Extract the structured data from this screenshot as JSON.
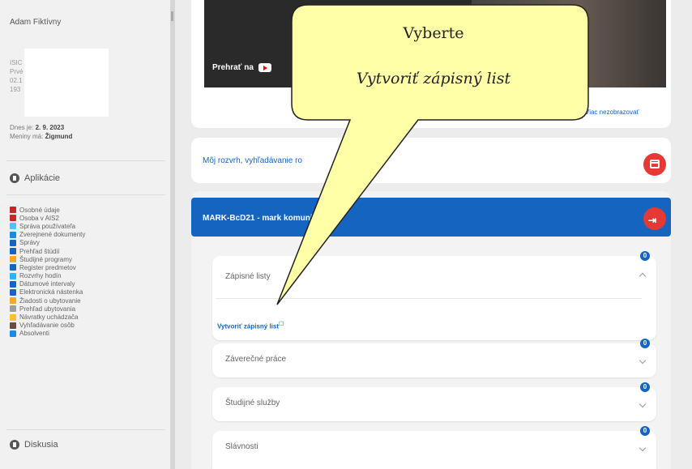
{
  "sidebar": {
    "user_name": "Adam Fiktívny",
    "id_labels": [
      "ISIC",
      "",
      "Prvé",
      "02.1",
      "193"
    ],
    "today_label": "Dnes je:",
    "today_date": "2. 9. 2023",
    "nameday_label": "Meniny má:",
    "nameday_name": "Žigmund",
    "apps_heading": "Aplikácie",
    "apps": [
      {
        "label": "Osobné údaje",
        "icon": "person-icon",
        "color": "#c62828"
      },
      {
        "label": "Osoba v AIS2",
        "icon": "person-icon",
        "color": "#c62828"
      },
      {
        "label": "Správa používateľa",
        "icon": "users-icon",
        "color": "#4fc3f7"
      },
      {
        "label": "Zverejnené dokumenty",
        "icon": "document-icon",
        "color": "#1e88e5"
      },
      {
        "label": "Správy",
        "icon": "mail-icon",
        "color": "#1565c0"
      },
      {
        "label": "Prehľad štúdií",
        "icon": "study-icon",
        "color": "#1565c0"
      },
      {
        "label": "Študijné programy",
        "icon": "program-icon",
        "color": "#f9a825"
      },
      {
        "label": "Register predmetov",
        "icon": "register-icon",
        "color": "#1565c0"
      },
      {
        "label": "Rozvrhy hodín",
        "icon": "timetable-icon",
        "color": "#29b6f6"
      },
      {
        "label": "Dátumové intervaly",
        "icon": "calendar-icon",
        "color": "#1565c0"
      },
      {
        "label": "Elektronická nástenka",
        "icon": "board-icon",
        "color": "#1565c0"
      },
      {
        "label": "Žiadosti o ubytovanie",
        "icon": "accommodation-icon",
        "color": "#f9a825"
      },
      {
        "label": "Prehľad ubytovania",
        "icon": "list-icon",
        "color": "#9e9e9e"
      },
      {
        "label": "Návratky uchádzača",
        "icon": "return-icon",
        "color": "#fbc02d"
      },
      {
        "label": "Vyhľadávanie osôb",
        "icon": "person-search-icon",
        "color": "#6d4c41"
      },
      {
        "label": "Absolventi",
        "icon": "graduate-icon",
        "color": "#1e88e5"
      }
    ],
    "discussion_heading": "Diskusia"
  },
  "video": {
    "watch_label": "Prehrať na",
    "more_link": "Viac nezobrazovať"
  },
  "schedule": {
    "text": "Môj rozvrh, vyhľadávanie ro"
  },
  "course": {
    "title": "MARK-BcD21 - mark                komunikácia"
  },
  "sections": [
    {
      "title": "Zápisné listy",
      "badge": "0",
      "link": "Vytvoriť zápisný list",
      "link_ext": "☐"
    },
    {
      "title": "Záverečné práce",
      "badge": "0"
    },
    {
      "title": "Študijné služby",
      "badge": "0"
    },
    {
      "title": "Slávnosti",
      "badge": "0"
    }
  ],
  "callout": {
    "line1": "Vyberte",
    "line2": "Vytvoriť zápisný list"
  },
  "colors": {
    "accent": "#1565c0",
    "danger": "#e53935",
    "callout_fill": "#ffffa8"
  }
}
